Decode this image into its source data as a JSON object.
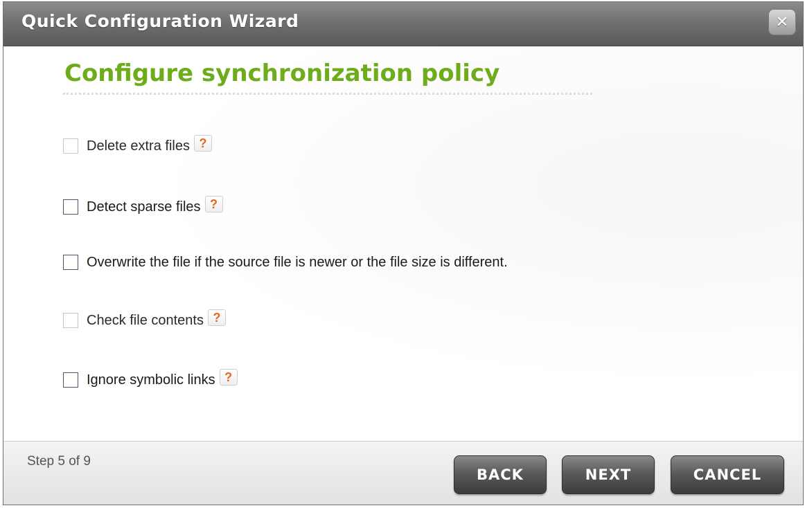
{
  "dialog": {
    "title": "Quick Configuration Wizard",
    "close_icon": "✕"
  },
  "heading": "Configure synchronization policy",
  "options": [
    {
      "label": "Delete extra files",
      "checked": false,
      "disabled": true,
      "has_help": true
    },
    {
      "label": "Detect sparse files",
      "checked": false,
      "disabled": false,
      "has_help": true
    },
    {
      "label": "Overwrite the file if the source file is newer or the file size is different.",
      "checked": false,
      "disabled": false,
      "has_help": false
    },
    {
      "label": "Check file contents",
      "checked": false,
      "disabled": true,
      "has_help": true
    },
    {
      "label": "Ignore symbolic links",
      "checked": false,
      "disabled": false,
      "has_help": true
    }
  ],
  "help_glyph": "?",
  "footer": {
    "step": "Step 5 of 9",
    "back_label": "BACK",
    "next_label": "NEXT",
    "cancel_label": "CANCEL"
  },
  "colors": {
    "heading": "#6fac1c",
    "help_icon": "#e2691f",
    "titlebar": "#6e6e6e"
  }
}
